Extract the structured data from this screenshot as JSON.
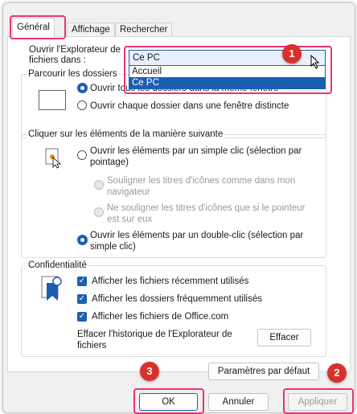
{
  "tabs": [
    "Général",
    "Affichage",
    "Rechercher"
  ],
  "open_explorer": {
    "label": "Ouvrir l'Explorateur de fichiers dans :",
    "selected": "Ce PC",
    "options": [
      "Accueil",
      "Ce PC"
    ]
  },
  "browse": {
    "label": "Parcourir les dossiers",
    "option_same": "Ouvrir tous les dossiers dans la même fenêtre",
    "option_distinct": "Ouvrir chaque dossier dans une fenêtre distincte"
  },
  "click": {
    "label": "Cliquer sur les éléments de la manière suivante",
    "single": "Ouvrir les éléments par un simple clic (sélection par pointage)",
    "underline_always": "Souligner les titres d'icônes comme dans mon navigateur",
    "underline_hover": "Ne souligner les titres d'icônes que si le pointeur est sur eux",
    "double": "Ouvrir les éléments par un double-clic (sélection par simple clic)"
  },
  "privacy": {
    "label": "Confidentialité",
    "recent_files": "Afficher les fichiers récemment utilisés",
    "frequent_folders": "Afficher les dossiers fréquemment utilisés",
    "office_files": "Afficher les fichiers de Office.com",
    "clear_label": "Effacer l'historique de l'Explorateur de fichiers",
    "clear_button": "Effacer"
  },
  "defaults_button": "Paramètres par défaut",
  "footer": {
    "ok": "OK",
    "cancel": "Annuler",
    "apply": "Appliquer"
  },
  "badges": [
    "1",
    "2",
    "3"
  ],
  "colors": {
    "accent": "#1a5fb4",
    "highlight": "#e8337a",
    "badge": "#d9302b"
  }
}
